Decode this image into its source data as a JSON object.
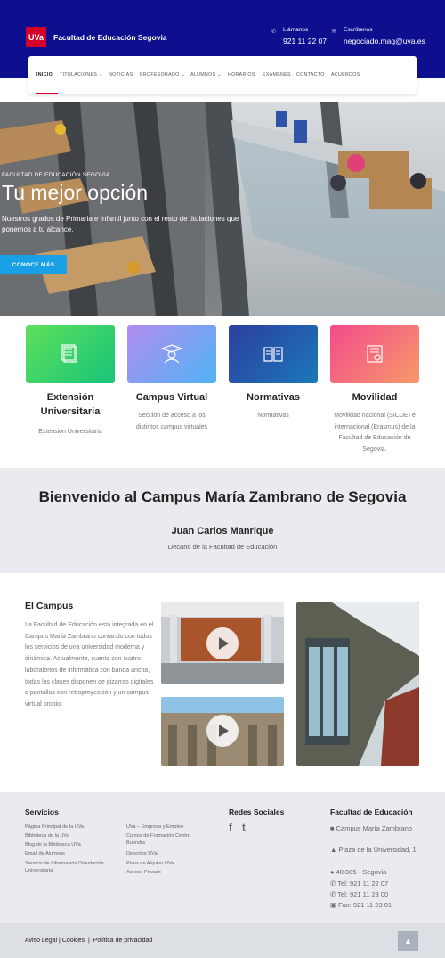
{
  "header": {
    "logo_text": "UVa",
    "site_title": "Facultad de Educación Segovia",
    "call": {
      "label": "Llámanos",
      "value": "921 11 22 07",
      "icon": "phone-icon"
    },
    "write": {
      "label": "Escríbenos",
      "value": "negociado.mag@uva.es",
      "icon": "envelope-icon"
    },
    "colors": {
      "primary": "#0d0f8f",
      "brand_red": "#d3002c",
      "accent_blue": "#1aa0e6"
    }
  },
  "nav": {
    "items": [
      {
        "label": "INICIO"
      },
      {
        "label": "TITULACIONES ⌄"
      },
      {
        "label": "NOTICIAS"
      },
      {
        "label": "PROFESORADO ⌄"
      },
      {
        "label": "ALUMNOS ⌄"
      },
      {
        "label": "HORARIOS"
      },
      {
        "label": "EXÁMENES"
      },
      {
        "label": "CONTACTO"
      },
      {
        "label": "ACUERDOS"
      }
    ]
  },
  "hero": {
    "kicker": "FACULTAD DE EDUCACIÓN SEGOVIA",
    "title": "Tu mejor opción",
    "subtitle": "Nuestros grados de Primaria e Infantil junto con el resto de titulaciones que ponemos a tu alcance.",
    "button": "CONOCE MÁS"
  },
  "cards": [
    {
      "title": "Extensión Universitaria",
      "desc": "Extensión Universitaria",
      "icon": "document-stack-icon"
    },
    {
      "title": "Campus Virtual",
      "desc": "Sección de acceso a los distintos campus virtuales",
      "icon": "graduate-icon"
    },
    {
      "title": "Normativas",
      "desc": "Normativas",
      "icon": "open-book-icon"
    },
    {
      "title": "Movilidad",
      "desc": "Movilidad nacional (SICUE) e internacional (Erasmus) de la Facultad de Educación de Segovia.",
      "icon": "certificate-icon"
    }
  ],
  "welcome": {
    "title": "Bienvenido al Campus María Zambrano de Segovia",
    "name": "Juan Carlos Manrique",
    "role": "Decano de la Facultad de Educación"
  },
  "campus": {
    "title": "El Campus",
    "text": "La Facultad de Educación está integrada en el Campus María Zambrano contando con todos los servicios de una universidad moderna y dinámica. Actualmente, cuenta con cuatro laboratorios de informática con banda ancha, todas las clases disponen de pizarras digitales o pantallas con retroproyección y un campus virtual propio."
  },
  "footer": {
    "services_title": "Servicios",
    "services_col1": [
      "Página Principal de la UVa",
      "Biblioteca de la UVa",
      "Blog de la Biblioteca UVa",
      "Email de Alumnos",
      "Servicio de Información Orientación Universitaria"
    ],
    "services_col2": [
      "UVa – Empresa y Empleo",
      "Cursos de Formación Centro Buendía",
      "Deportes UVa",
      "Pisos de Alquiler UVa",
      "Acceso Privado"
    ],
    "social_title": "Redes Sociales",
    "social": {
      "facebook": "f",
      "twitter": "t"
    },
    "faculty_title": "Facultad de Educación",
    "address": [
      {
        "icon": "building-icon",
        "text": "Campus María Zambrano"
      },
      {
        "icon": "graduation-cap-icon",
        "text": "Plaza de la Universidad, 1"
      },
      {
        "icon": "map-marker-icon",
        "text": "40.005 - Segovia"
      },
      {
        "icon": "phone-icon",
        "text": "Tel: 921 11 22 07"
      },
      {
        "icon": "phone-icon",
        "text": "Tel: 921 11 23 00"
      },
      {
        "icon": "fax-icon",
        "text": "Fax: 921 11 23 01"
      }
    ],
    "legal": {
      "aviso": "Aviso Legal",
      "cookies": "Cookies",
      "privacy": "Política de privacidad",
      "sep": "|"
    },
    "to_top": "▲"
  }
}
